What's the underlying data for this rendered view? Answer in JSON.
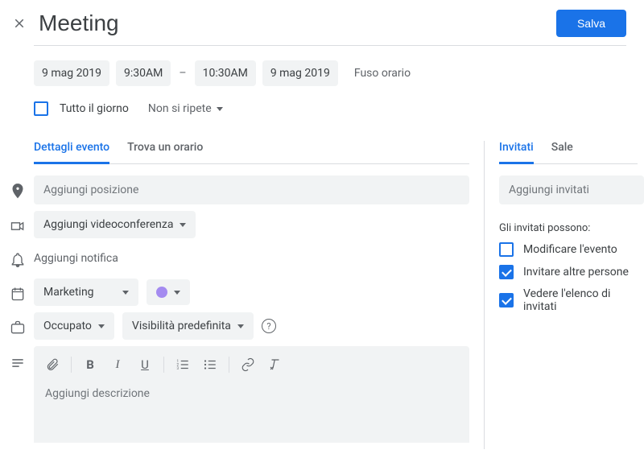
{
  "header": {
    "title": "Meeting",
    "save_label": "Salva"
  },
  "datetime": {
    "start_date": "9 mag 2019",
    "start_time": "9:30AM",
    "end_time": "10:30AM",
    "end_date": "9 mag 2019",
    "timezone_label": "Fuso orario"
  },
  "allday": {
    "label": "Tutto il giorno",
    "repeat": "Non si ripete"
  },
  "tabs_left": {
    "details": "Dettagli evento",
    "find_time": "Trova un orario"
  },
  "fields": {
    "location_placeholder": "Aggiungi posizione",
    "video_label": "Aggiungi videoconferenza",
    "notification_label": "Aggiungi notifica",
    "calendar_name": "Marketing",
    "availability": "Occupato",
    "visibility": "Visibilità predefinita",
    "description_placeholder": "Aggiungi descrizione"
  },
  "tabs_right": {
    "guests": "Invitati",
    "rooms": "Sale"
  },
  "guests": {
    "input_placeholder": "Aggiungi invitati",
    "permissions_title": "Gli invitati possono:",
    "perm_modify": "Modificare l'evento",
    "perm_invite": "Invitare altre persone",
    "perm_see_list": "Vedere l'elenco di invitati"
  }
}
